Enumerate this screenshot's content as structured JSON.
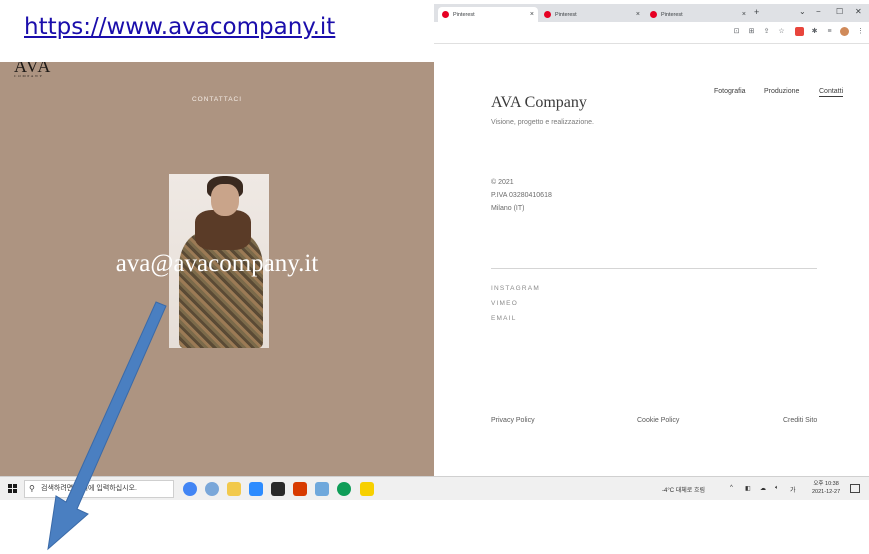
{
  "overlay": {
    "url": "https://www.avacompany.it"
  },
  "browser": {
    "tabs": [
      {
        "label": "Pinterest"
      },
      {
        "label": "Pinterest"
      },
      {
        "label": "Pinterest"
      }
    ],
    "new_tab": "+",
    "window_controls": {
      "minimize": "−",
      "maximize": "☐",
      "close": "✕"
    }
  },
  "left_page": {
    "logo_mark": "AVA",
    "logo_sub": "COMPANY",
    "contact_heading": "CONTATTACI",
    "email": "ava@avacompany.it"
  },
  "right_page": {
    "nav": [
      "Fotografia",
      "Produzione",
      "Contatti"
    ],
    "title": "AVA Company",
    "tagline": "Visione, progetto e realizzazione.",
    "info": [
      "© 2021",
      "P.IVA 03280410618",
      "Milano (IT)"
    ],
    "social": [
      "INSTAGRAM",
      "VIMEO",
      "EMAIL"
    ],
    "footer": {
      "privacy": "Privacy Policy",
      "cookie": "Cookie Policy",
      "credits": "Crediti Sito"
    }
  },
  "taskbar": {
    "search_placeholder": "검색하려면 여기에 입력하십시오.",
    "weather": "-4°C 대체로 흐림",
    "time": "오후 10:38",
    "date": "2021-12-27",
    "accent": "#4a7fc1"
  }
}
